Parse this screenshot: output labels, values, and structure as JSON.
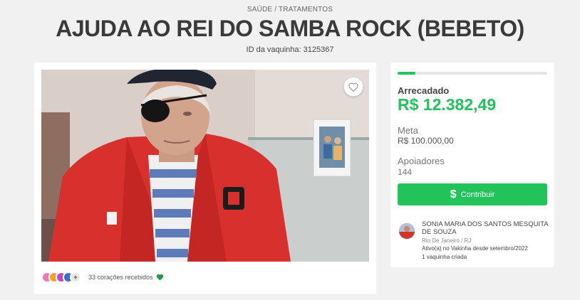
{
  "campaign": {
    "category": "SAÚDE / TRATAMENTOS",
    "title": "AJUDA AO REI DO SAMBA ROCK (BEBETO)",
    "id_label": "ID da vaquinha: 3125367"
  },
  "media": {
    "favorite_icon": "heart-outline-icon",
    "hearts_text": "33 corações recebidos",
    "hearts_icon": "green-heart-icon",
    "more_badge": "+"
  },
  "stats": {
    "progress_fraction": 0.12,
    "raised_label": "Arrecadado",
    "raised_value": "R$ 12.382,49",
    "goal_label": "Meta",
    "goal_value": "R$ 100.000,00",
    "backers_label": "Apoiadores",
    "backers_value": "144",
    "contribute_label": "Contribuir",
    "contribute_icon": "dollar-icon"
  },
  "organizer": {
    "name": "SONIA MARIA DOS SANTOS MESQUITA DE SOUZA",
    "location": "Rio De Janeiro / RJ",
    "active_since": "Ativo(a) no Vakinha desde setembro/2022",
    "campaigns_created": "1 vaquinha criada"
  },
  "colors": {
    "accent": "#22c35b",
    "background": "#f1f1f1",
    "title": "#3a3a3a"
  }
}
